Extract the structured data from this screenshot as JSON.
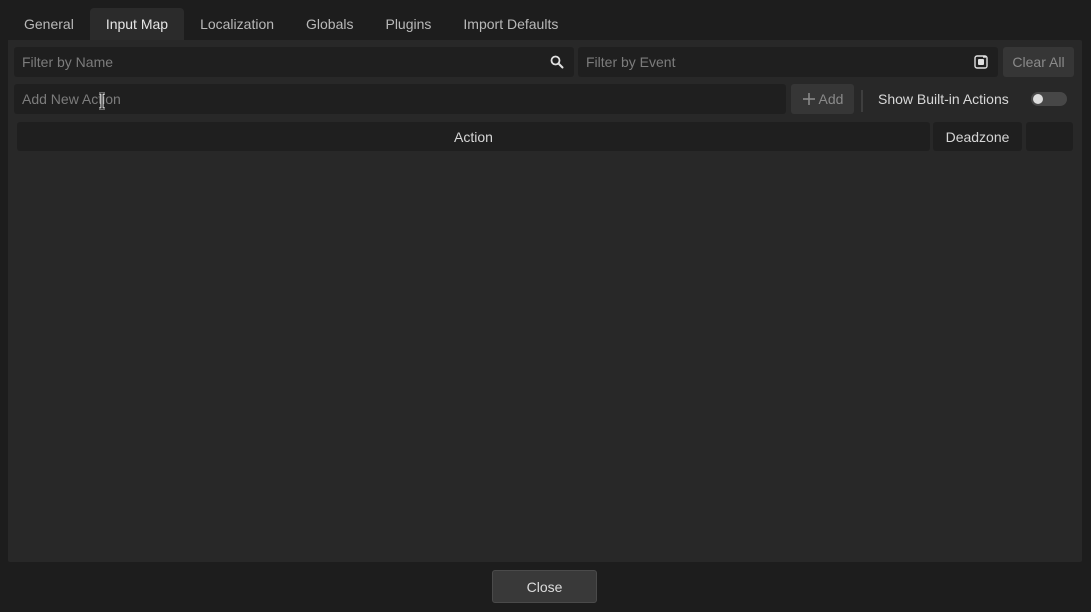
{
  "tabs": [
    {
      "label": "General"
    },
    {
      "label": "Input Map"
    },
    {
      "label": "Localization"
    },
    {
      "label": "Globals"
    },
    {
      "label": "Plugins"
    },
    {
      "label": "Import Defaults"
    }
  ],
  "active_tab": "Input Map",
  "filter": {
    "name_placeholder": "Filter by Name",
    "event_placeholder": "Filter by Event",
    "name_icon": "search-icon",
    "event_icon": "keyboard-listen-icon",
    "clear_label": "Clear All"
  },
  "add_action": {
    "placeholder": "Add New Action",
    "add_label": "Add",
    "add_icon": "plus-icon"
  },
  "builtin": {
    "label": "Show Built-in Actions",
    "enabled": false
  },
  "table": {
    "columns": [
      "Action",
      "Deadzone",
      ""
    ],
    "rows": []
  },
  "footer": {
    "close_label": "Close"
  },
  "colors": {
    "background": "#1d1d1d",
    "panel": "#282828",
    "field": "#1f1f1f",
    "button": "#363636"
  }
}
